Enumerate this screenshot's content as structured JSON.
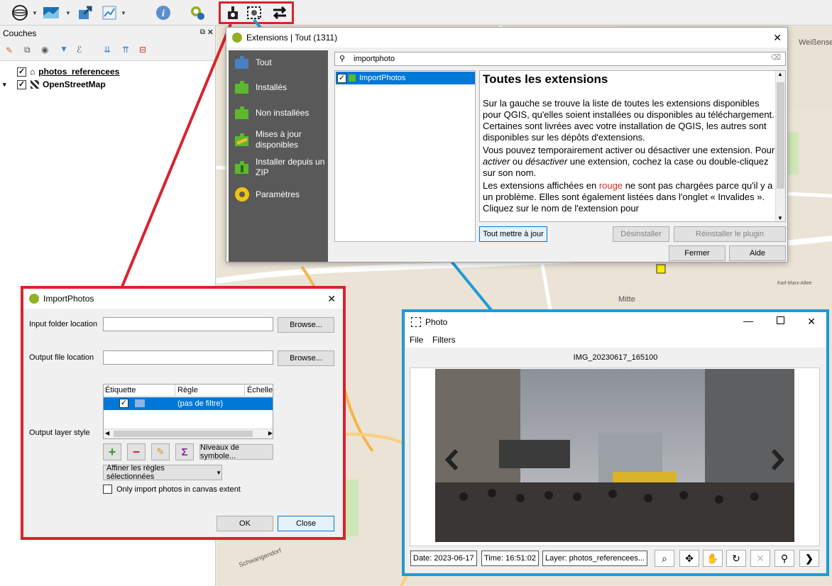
{
  "toolbar": {
    "icons": [
      "globe-icon",
      "map-layer-icon",
      "export-icon",
      "chart-icon",
      "info-icon",
      "qgis-search-icon",
      "import-photos-icon",
      "photo-viewer-icon",
      "swap-arrows-icon"
    ]
  },
  "layers": {
    "title": "Couches",
    "items": [
      {
        "label": "photos_referencees",
        "checked": true
      },
      {
        "label": "OpenStreetMap",
        "checked": true
      }
    ]
  },
  "map": {
    "labels": [
      "Weißense",
      "Mitte",
      "Karl-Marx-Allee"
    ],
    "street_labels": [
      "Schwangendorf"
    ]
  },
  "extensions": {
    "title": "Extensions | Tout (1311)",
    "nav": [
      {
        "label": "Tout"
      },
      {
        "label": "Installés"
      },
      {
        "label": "Non installées"
      },
      {
        "label": "Mises à jour disponibles"
      },
      {
        "label": "Installer depuis un ZIP"
      },
      {
        "label": "Paramètres"
      }
    ],
    "search_value": "importphoto",
    "list": [
      {
        "label": "ImportPhotos",
        "checked": true
      }
    ],
    "heading": "Toutes les extensions",
    "p1": "Sur la gauche se trouve la liste de toutes les extensions disponibles pour QGIS, qu'elles soient installées ou disponibles au téléchargement. Certaines sont livrées avec votre installation de QGIS, les autres sont disponibles sur les dépôts d'extensions.",
    "p2_pre": "Vous pouvez temporairement activer ou désactiver une extension. Pour ",
    "p2_activer": "activer",
    "p2_ou": " ou ",
    "p2_desactiver": "désactiver",
    "p2_post": " une extension, cochez la case ou double-cliquez sur son nom.",
    "p3_pre": "Les extensions affichées en ",
    "p3_rouge": "rouge",
    "p3_post": " ne sont pas chargées parce qu'il y a un problème. Elles sont également listées dans l'onglet « Invalides ». Cliquez sur le nom de l'extension pour",
    "buttons": {
      "update_all": "Tout mettre à jour",
      "uninstall": "Désinstaller",
      "reinstall": "Réinstaller le plugin",
      "close": "Fermer",
      "help": "Aide"
    }
  },
  "import_photos": {
    "title": "ImportPhotos",
    "input_folder_label": "Input folder location",
    "output_file_label": "Output file location",
    "browse": "Browse...",
    "style_label": "Output layer style",
    "table_headers": [
      "Étiquette",
      "Règle",
      "Échelle"
    ],
    "rule_row": "(pas de filtre)",
    "symbol_levels": "Niveaux de symbole...",
    "refine": "Affiner les règles sélectionnées",
    "canvas_extent_label": "Only import photos in canvas extent",
    "ok": "OK",
    "close": "Close"
  },
  "photo": {
    "title": "Photo",
    "menu": [
      "File",
      "Filters"
    ],
    "filename": "IMG_20230617_165100",
    "date": "Date: 2023-06-17",
    "time": "Time: 16:51:02",
    "layer": "Layer: photos_referencees..."
  },
  "colors": {
    "red_frame": "#d9232d",
    "blue_frame": "#1f9ad6",
    "selection": "#0078d7",
    "nav_bg": "#595959"
  }
}
